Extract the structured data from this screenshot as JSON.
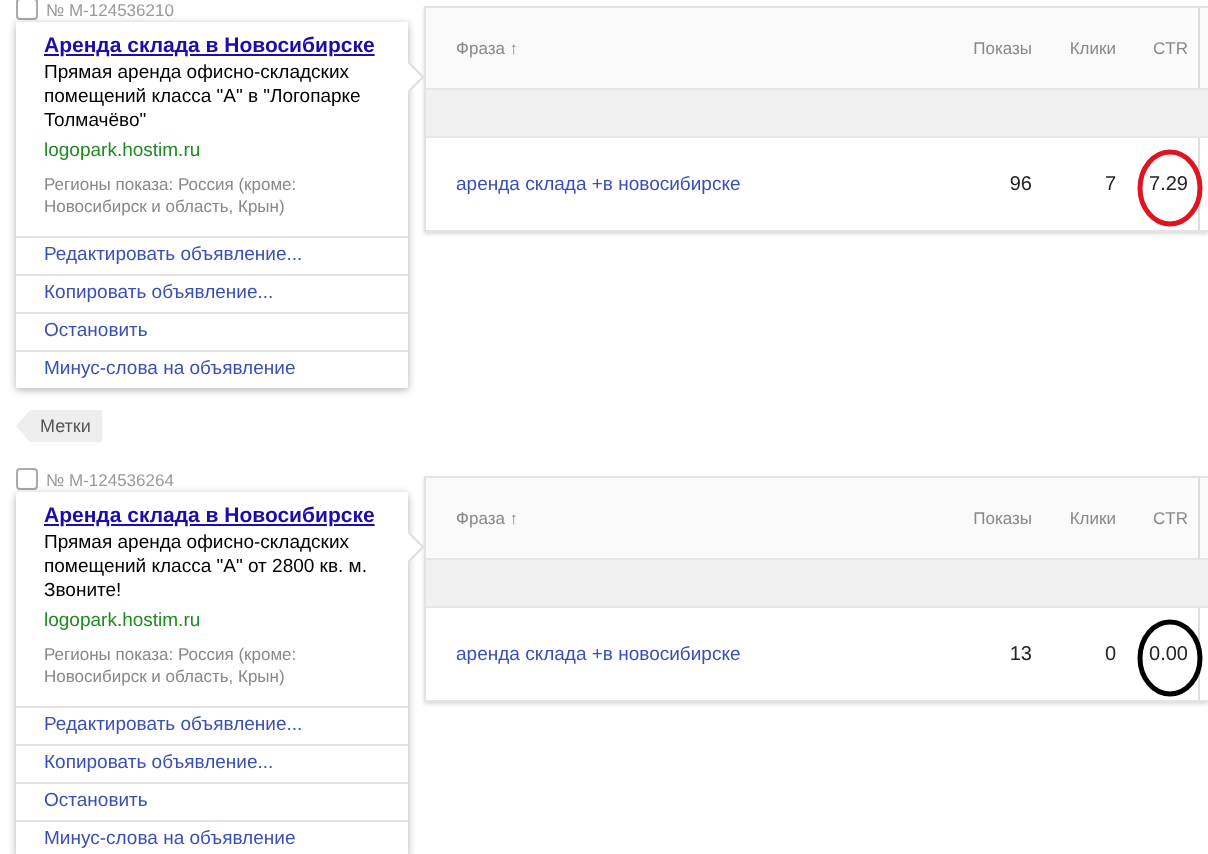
{
  "ads": [
    {
      "number": "№ M-124536210",
      "checked": false,
      "title": "Аренда склада в Новосибирске",
      "text": "Прямая аренда офисно-складских помещений класса \"А\" в \"Логопарке Толмачёво\"",
      "url": "logopark.hostim.ru",
      "regions": "Регионы показа: Россия (кроме: Новосибирск и область, Крын)",
      "actions": [
        "Редактировать объявление...",
        "Копировать объявление...",
        "Остановить",
        "Минус-слова на объявление"
      ],
      "table": {
        "columns": [
          "Фраза ↑",
          "Показы",
          "Клики",
          "CTR"
        ],
        "rows": [
          {
            "phrase": "аренда склада +в новосибирске",
            "shows": "96",
            "clicks": "7",
            "ctr": "7.29",
            "circle": {
              "color": "#e0141e"
            }
          }
        ]
      },
      "tag": "Метки"
    },
    {
      "number": "№ M-124536264",
      "checked": false,
      "title": "Аренда склада в Новосибирске",
      "text": "Прямая аренда офисно-складских помещений класса \"А\" от 2800 кв. м. Звоните!",
      "url": "logopark.hostim.ru",
      "regions": "Регионы показа: Россия (кроме: Новосибирск и область, Крын)",
      "actions": [
        "Редактировать объявление...",
        "Копировать объявление...",
        "Остановить",
        "Минус-слова на объявление"
      ],
      "table": {
        "columns": [
          "Фраза ↑",
          "Показы",
          "Клики",
          "CTR"
        ],
        "rows": [
          {
            "phrase": "аренда склада +в новосибирске",
            "shows": "13",
            "clicks": "0",
            "ctr": "0.00",
            "circle": {
              "color": "#000000"
            }
          }
        ]
      }
    }
  ]
}
